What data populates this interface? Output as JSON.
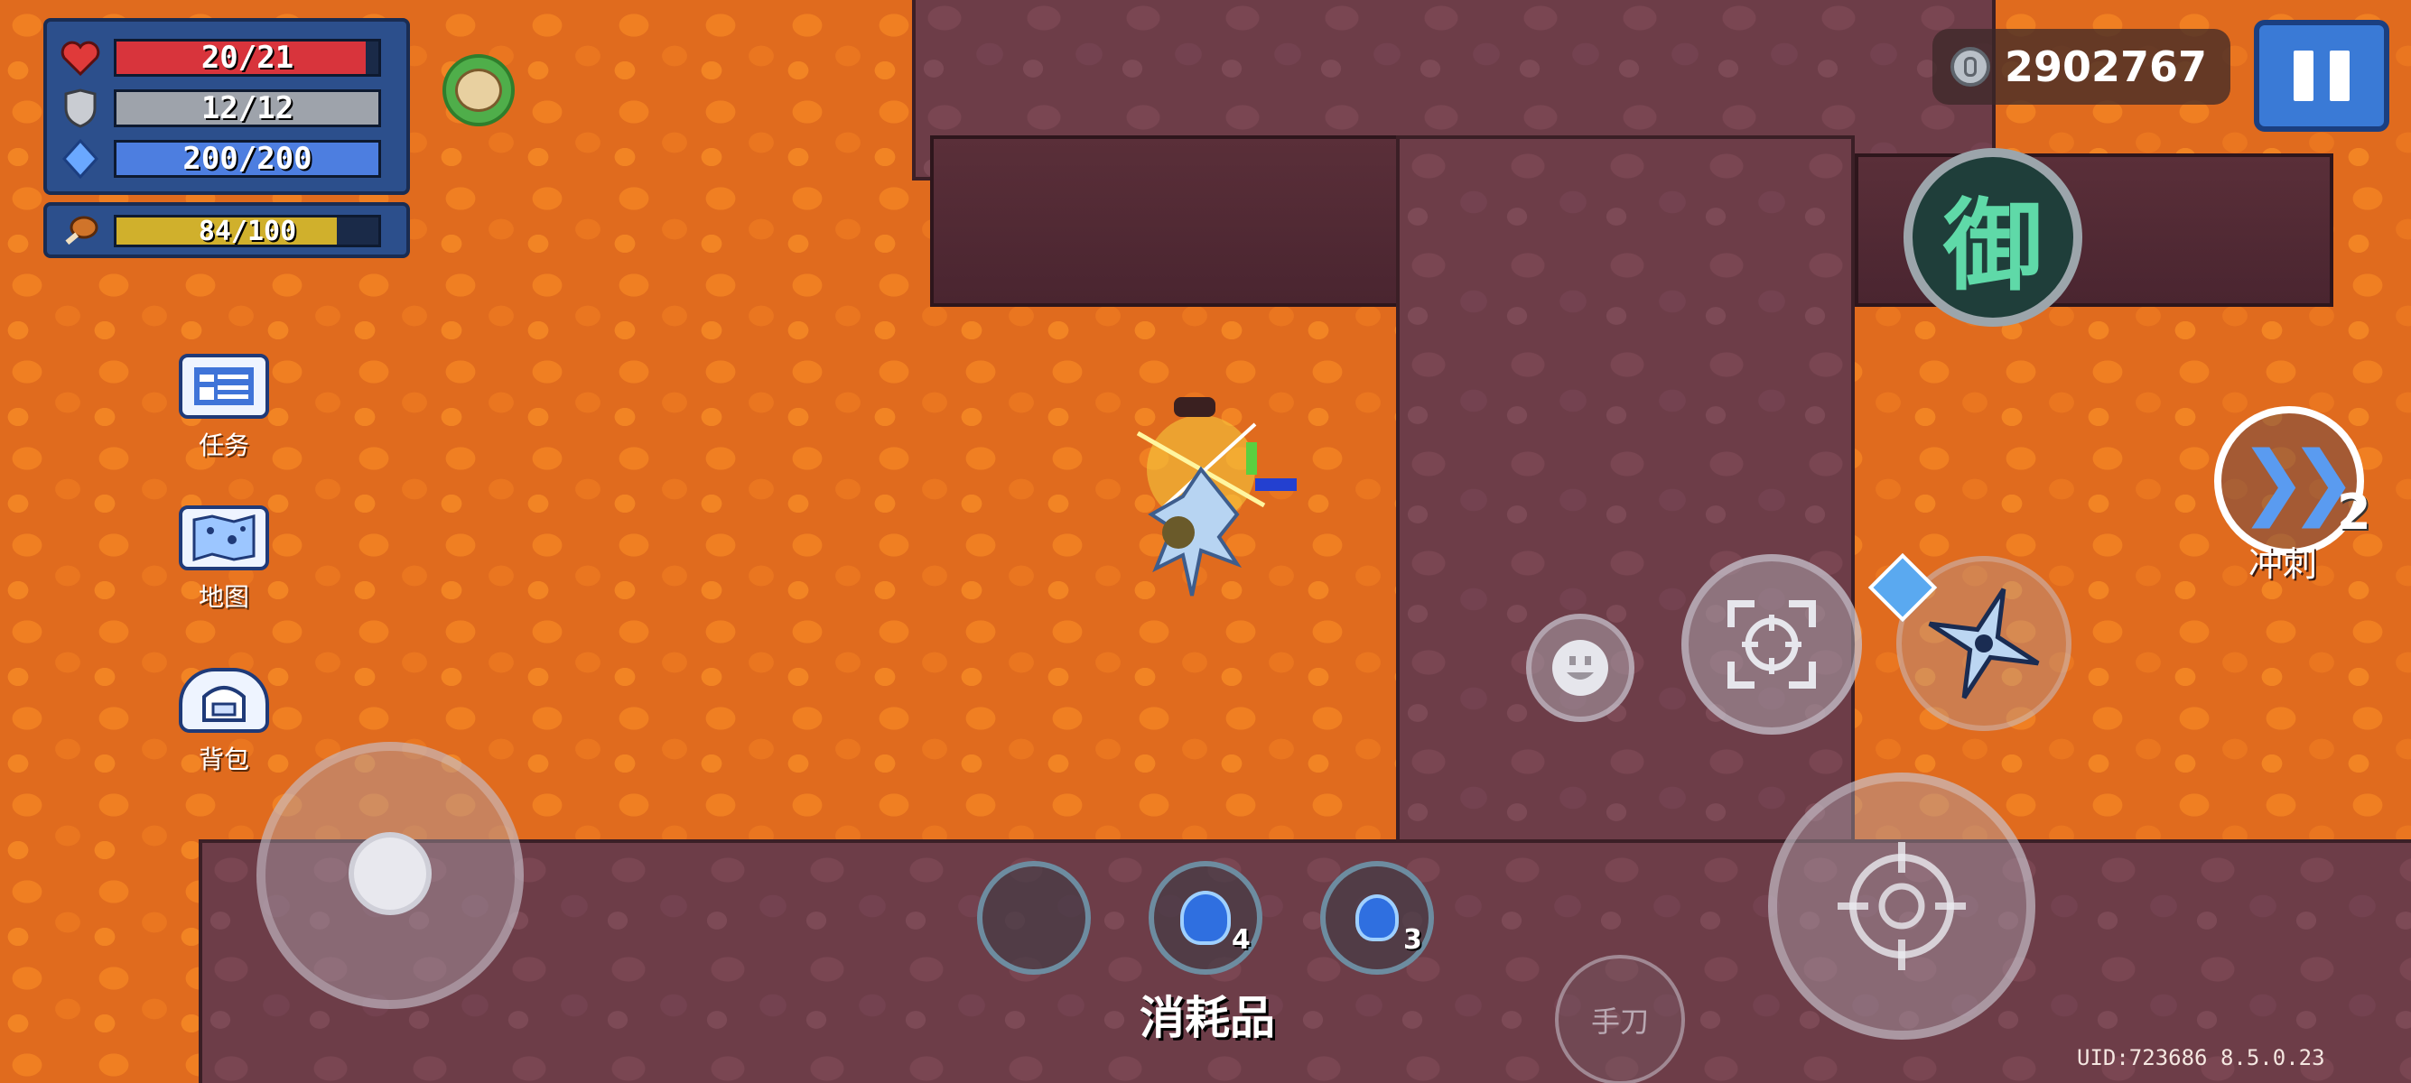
{
  "hud": {
    "hp": {
      "text": "20/21",
      "fraction": 0.952,
      "color": "#d8343c"
    },
    "armor": {
      "text": "12/12",
      "fraction": 1.0,
      "color": "#9ea3ab"
    },
    "energy": {
      "text": "200/200",
      "fraction": 1.0,
      "color": "#4d7ee0"
    },
    "hunger": {
      "text": "84/100",
      "fraction": 0.84,
      "color": "#d0b02c"
    }
  },
  "buff": {
    "icon": "explorer-hat-buff-icon"
  },
  "side_menu": {
    "quest_label": "任务",
    "map_label": "地图",
    "bag_label": "背包"
  },
  "currency": {
    "icon": "gem-coin-icon",
    "value": "2902767"
  },
  "controls": {
    "skill_char": "御",
    "dash_label": "冲刺",
    "dash_count": "2",
    "melee_label": "手刀",
    "consumables_label": "消耗品"
  },
  "consumables": [
    {
      "icon": "empty-slot",
      "count": ""
    },
    {
      "icon": "blue-potion-icon",
      "count": "4"
    },
    {
      "icon": "blue-potion-icon",
      "count": "3"
    }
  ],
  "footer": {
    "uid": "UID:723686 8.5.0.23"
  },
  "colors": {
    "lava": "#e06b1e",
    "rock": "#6d3d48",
    "accent": "#3a7ad6"
  }
}
